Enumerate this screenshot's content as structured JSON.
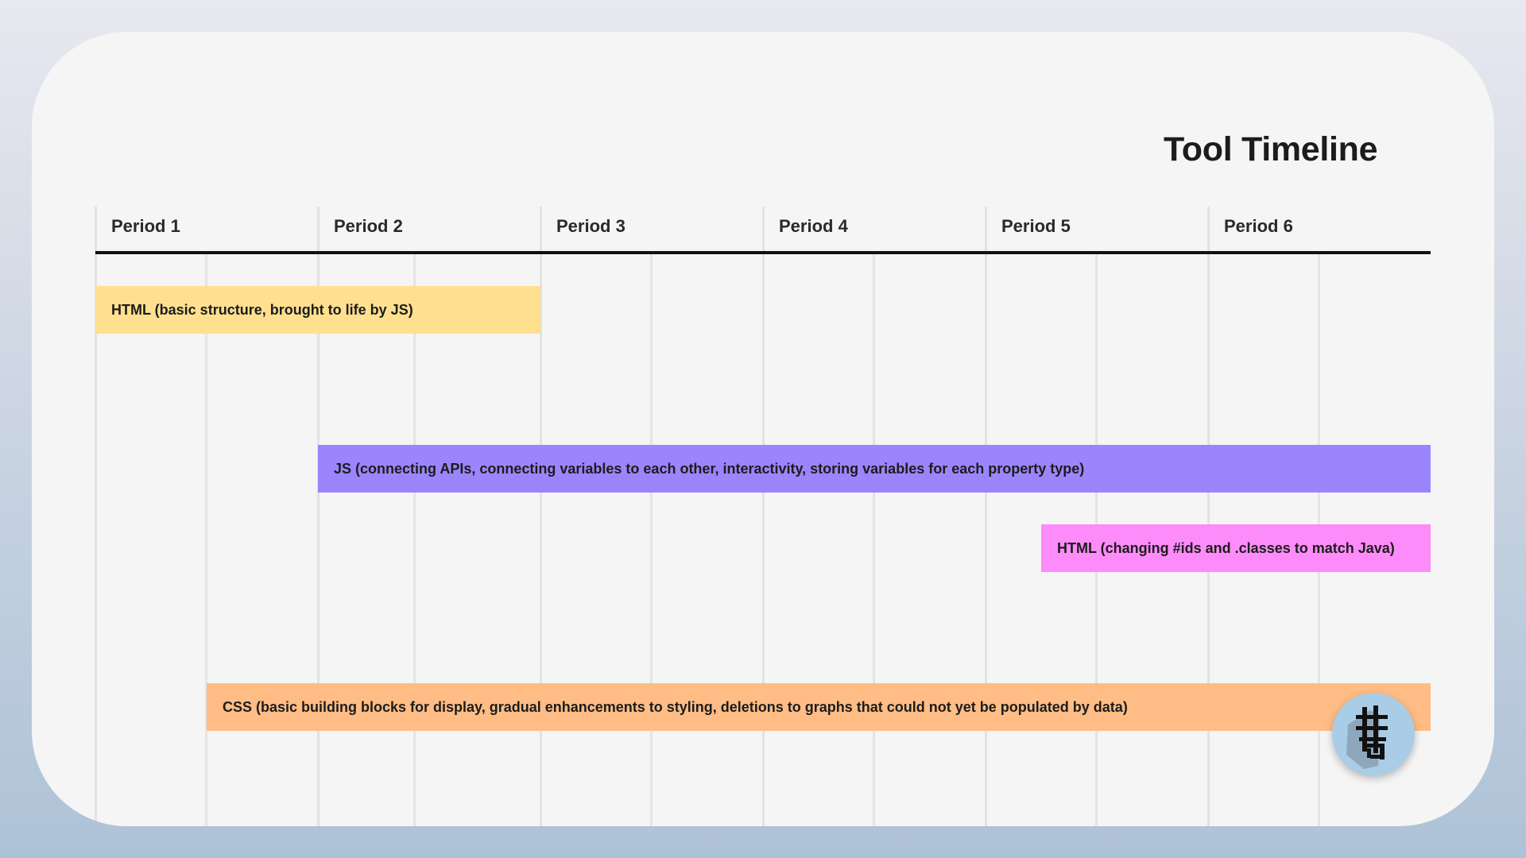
{
  "title": "Tool Timeline",
  "periods": [
    "Period 1",
    "Period 2",
    "Period 3",
    "Period 4",
    "Period 5",
    "Period 6"
  ],
  "bars": [
    {
      "label": "HTML (basic structure, brought to life by JS)",
      "color": "#ffe08f",
      "start": 1.0,
      "end": 3.0
    },
    {
      "label": "JS (connecting APIs, connecting variables to each other, interactivity, storing variables for each property type)",
      "color": "#9b85fc",
      "start": 2.0,
      "end": 7.0
    },
    {
      "label": "HTML (changing #ids and .classes to match Java)",
      "color": "#fd8bf9",
      "start": 5.25,
      "end": 7.0
    },
    {
      "label": "CSS (basic building blocks for display, gradual enhancements to styling, deletions to graphs that could not yet be populated by data)",
      "color": "#ffbd85",
      "start": 1.5,
      "end": 7.0
    }
  ],
  "avatar": {
    "icon": "user-avatar-icon",
    "color": "#a9cde6"
  }
}
